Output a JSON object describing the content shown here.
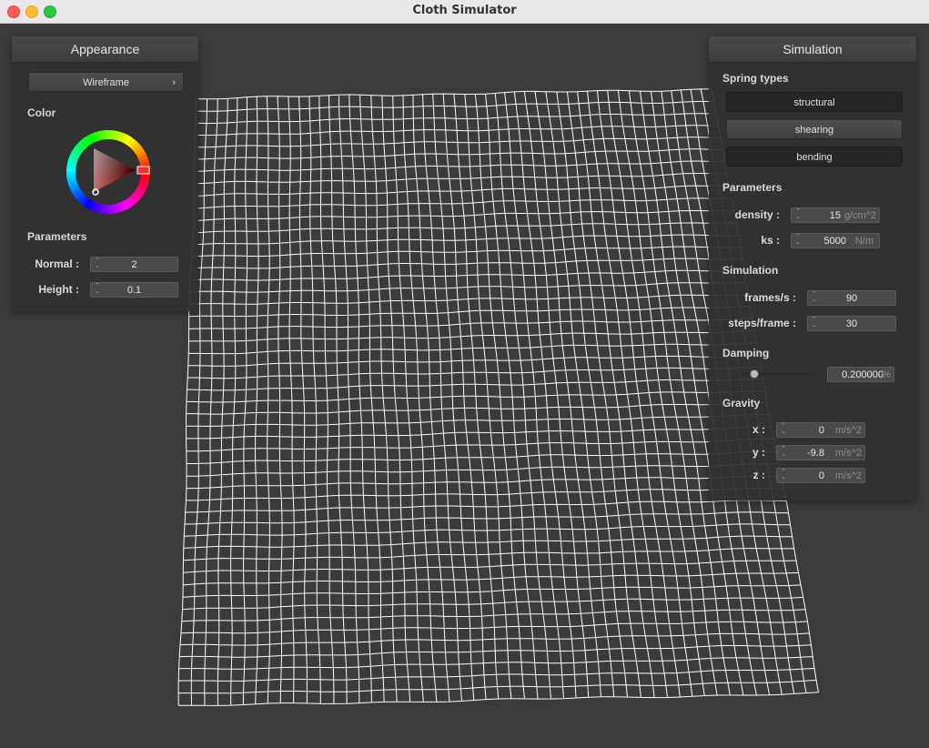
{
  "window": {
    "title": "Cloth Simulator"
  },
  "appearance": {
    "title": "Appearance",
    "shader_label": "Wireframe",
    "shader_arrow": "›",
    "color_label": "Color",
    "selected_color": "#ff0000",
    "parameters_label": "Parameters",
    "normal": {
      "label": "Normal :",
      "value": "2"
    },
    "height": {
      "label": "Height :",
      "value": "0.1"
    }
  },
  "simulation": {
    "title": "Simulation",
    "spring_types_label": "Spring types",
    "spring_types": [
      {
        "label": "structural",
        "active": true
      },
      {
        "label": "shearing",
        "active": false
      },
      {
        "label": "bending",
        "active": true
      }
    ],
    "parameters_label": "Parameters",
    "density": {
      "label": "density :",
      "value": "15",
      "unit": "g/cm^2"
    },
    "ks": {
      "label": "ks :",
      "value": "5000",
      "unit": "N/m"
    },
    "simulation_label": "Simulation",
    "fps": {
      "label": "frames/s :",
      "value": "90"
    },
    "steps": {
      "label": "steps/frame :",
      "value": "30"
    },
    "damping_label": "Damping",
    "damping": {
      "value": "0.200000",
      "unit": "%",
      "fraction": 0.2
    },
    "gravity_label": "Gravity",
    "gx": {
      "label": "x :",
      "value": "0",
      "unit": "m/s^2"
    },
    "gy": {
      "label": "y :",
      "value": "-9.8",
      "unit": "m/s^2"
    },
    "gz": {
      "label": "z :",
      "value": "0",
      "unit": "m/s^2"
    }
  },
  "cloth": {
    "grid_divisions": 50,
    "line_color": "#ffffff",
    "background": "#3b3b3b"
  }
}
